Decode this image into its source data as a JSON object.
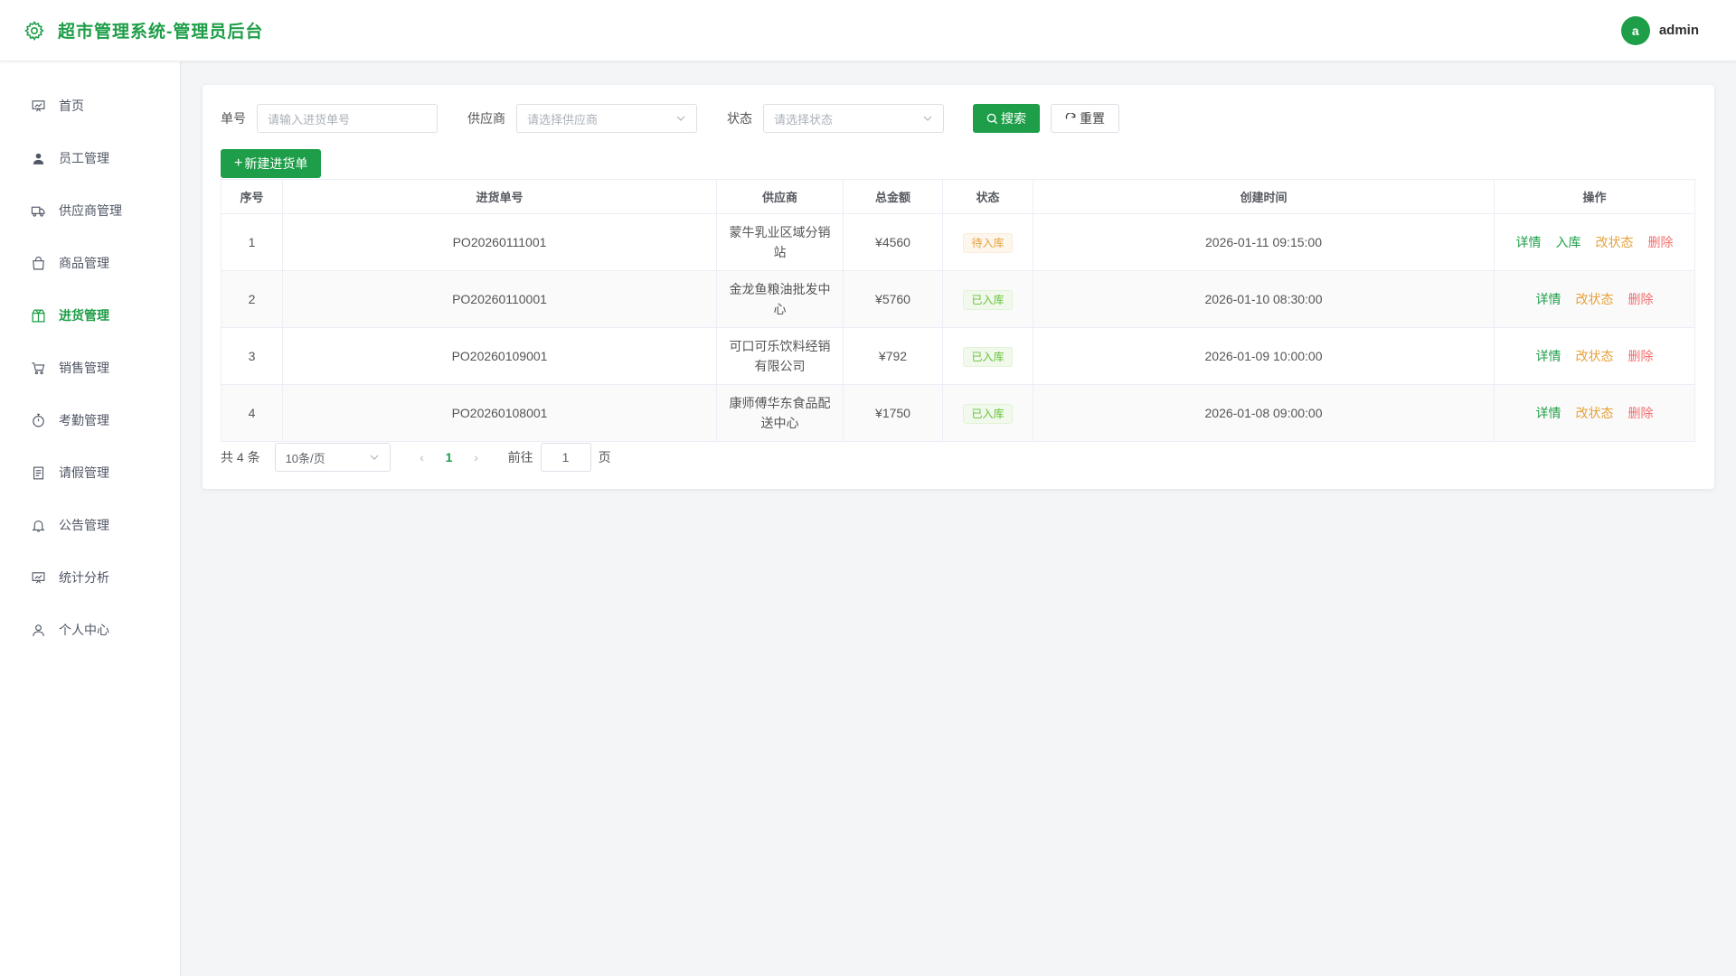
{
  "header": {
    "title": "超市管理系统-管理员后台",
    "logo_icon": "gear-icon",
    "user_initial": "a",
    "username": "admin",
    "accent": "#1e9e48"
  },
  "sidebar": {
    "items": [
      {
        "label": "首页",
        "icon": "chart-board-icon",
        "active": false
      },
      {
        "label": "员工管理",
        "icon": "user-icon",
        "active": false
      },
      {
        "label": "供应商管理",
        "icon": "truck-icon",
        "active": false
      },
      {
        "label": "商品管理",
        "icon": "shopping-bag-icon",
        "active": false
      },
      {
        "label": "进货管理",
        "icon": "box-icon",
        "active": true
      },
      {
        "label": "销售管理",
        "icon": "cart-icon",
        "active": false
      },
      {
        "label": "考勤管理",
        "icon": "stopwatch-icon",
        "active": false
      },
      {
        "label": "请假管理",
        "icon": "document-icon",
        "active": false
      },
      {
        "label": "公告管理",
        "icon": "bell-icon",
        "active": false
      },
      {
        "label": "统计分析",
        "icon": "chart-board-icon",
        "active": false
      },
      {
        "label": "个人中心",
        "icon": "person-icon",
        "active": false
      }
    ]
  },
  "filters": {
    "order_label": "单号",
    "order_placeholder": "请输入进货单号",
    "supplier_label": "供应商",
    "supplier_placeholder": "请选择供应商",
    "status_label": "状态",
    "status_placeholder": "请选择状态",
    "search_label": "搜索",
    "reset_label": "重置"
  },
  "new_button_label": "新建进货单",
  "table": {
    "headers": [
      "序号",
      "进货单号",
      "供应商",
      "总金额",
      "状态",
      "创建时间",
      "操作"
    ],
    "rows": [
      {
        "index": "1",
        "order_no": "PO20260111001",
        "supplier": "蒙牛乳业区域分销站",
        "amount": "¥4560",
        "status": "待入库",
        "status_type": "pending",
        "created": "2026-01-11 09:15:00",
        "actions": [
          "详情",
          "入库",
          "改状态",
          "删除"
        ]
      },
      {
        "index": "2",
        "order_no": "PO20260110001",
        "supplier": "金龙鱼粮油批发中心",
        "amount": "¥5760",
        "status": "已入库",
        "status_type": "done",
        "created": "2026-01-10 08:30:00",
        "actions": [
          "详情",
          "改状态",
          "删除"
        ]
      },
      {
        "index": "3",
        "order_no": "PO20260109001",
        "supplier": "可口可乐饮料经销有限公司",
        "amount": "¥792",
        "status": "已入库",
        "status_type": "done",
        "created": "2026-01-09 10:00:00",
        "actions": [
          "详情",
          "改状态",
          "删除"
        ]
      },
      {
        "index": "4",
        "order_no": "PO20260108001",
        "supplier": "康师傅华东食品配送中心",
        "amount": "¥1750",
        "status": "已入库",
        "status_type": "done",
        "created": "2026-01-08 09:00:00",
        "actions": [
          "详情",
          "改状态",
          "删除"
        ]
      }
    ]
  },
  "pagination": {
    "total_text": "共 4 条",
    "page_size": "10条/页",
    "current_page": "1",
    "goto_label": "前往",
    "goto_value": "1",
    "page_suffix": "页"
  }
}
